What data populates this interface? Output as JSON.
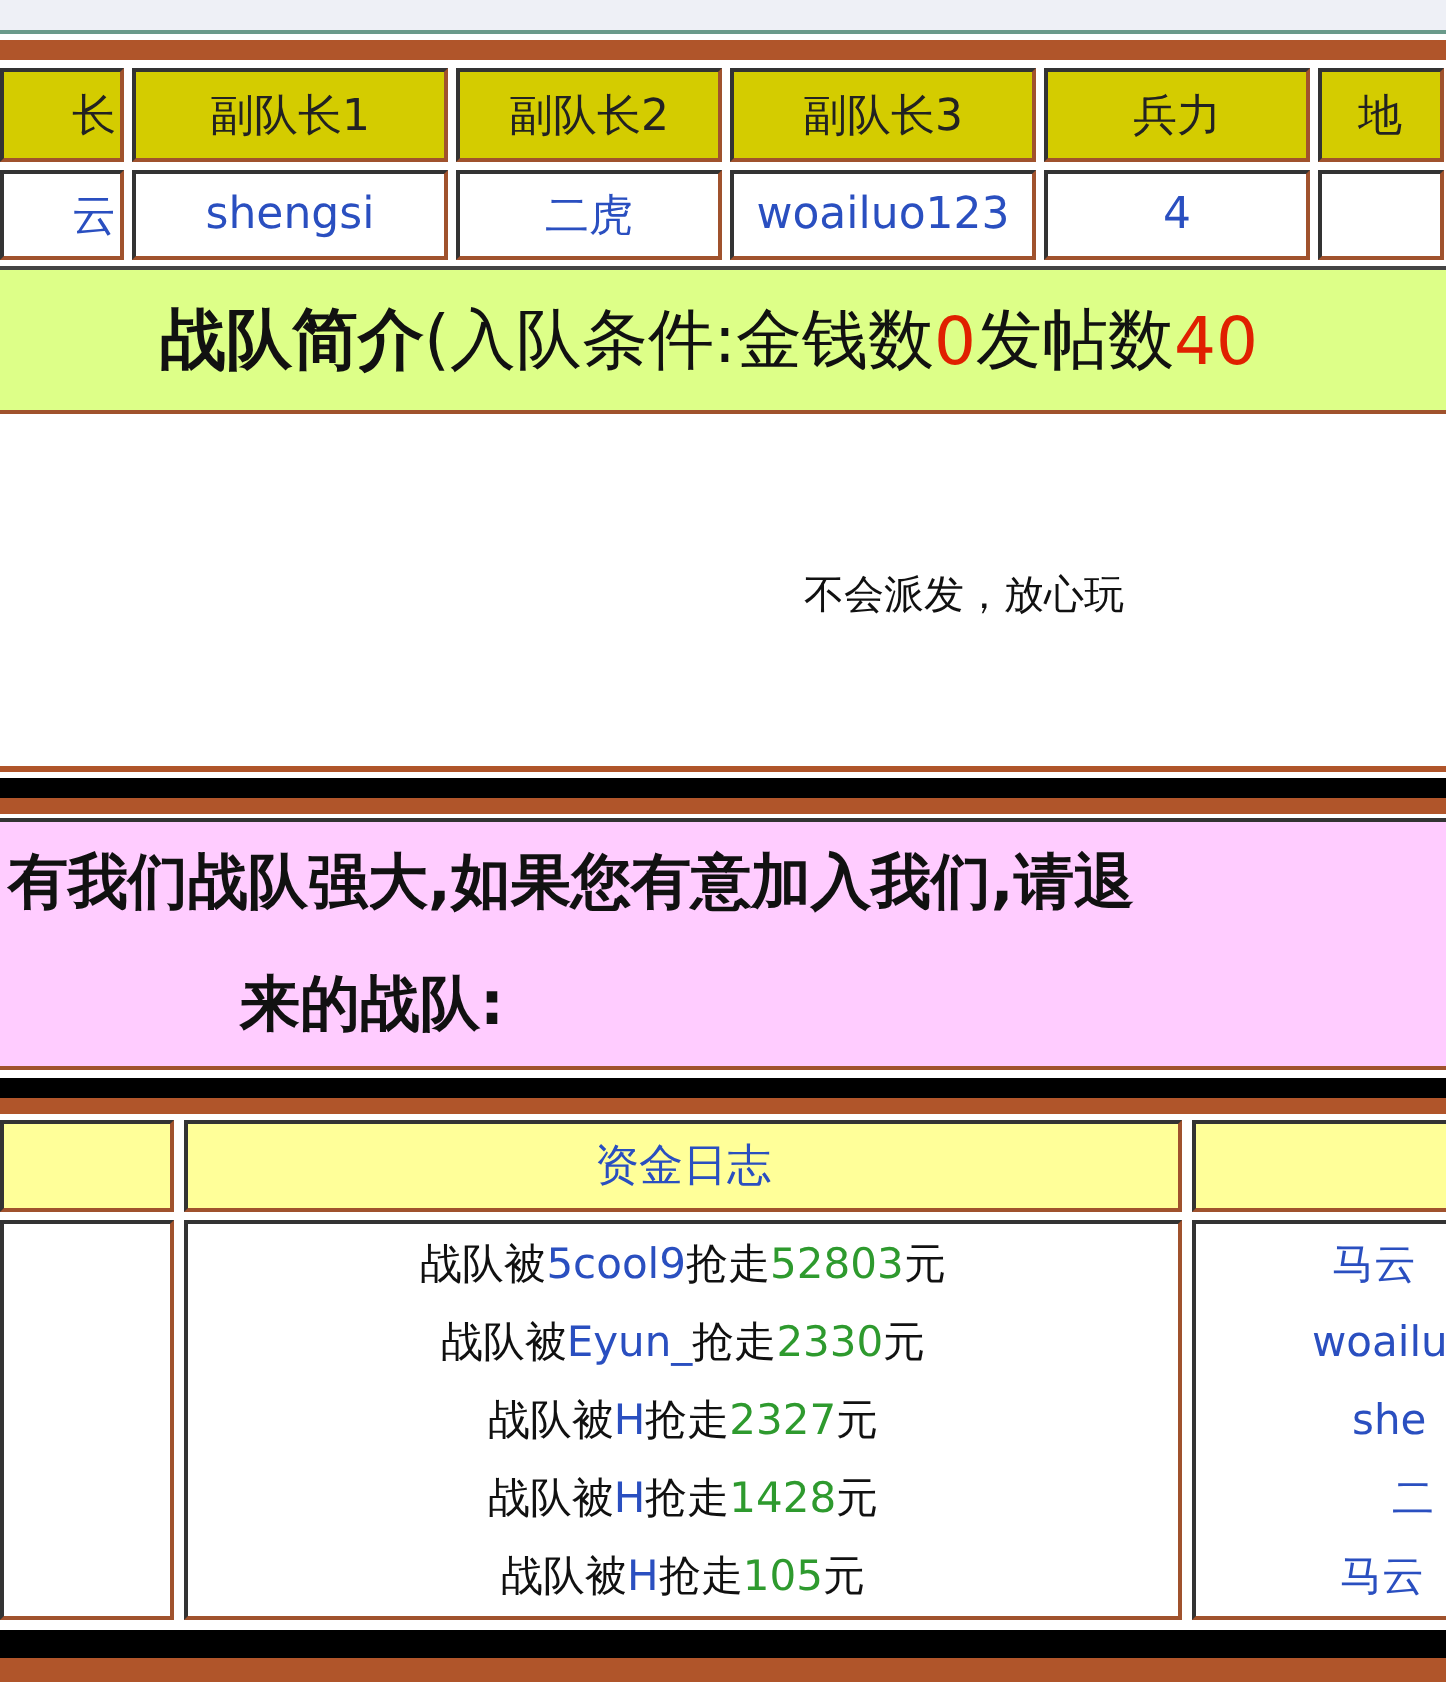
{
  "team_table": {
    "headers": [
      "长",
      "副队长1",
      "副队长2",
      "副队长3",
      "兵力",
      "地"
    ],
    "row": [
      "云",
      "shengsi",
      "二虎",
      "woailuo123",
      "4"
    ]
  },
  "intro_bar": {
    "label": "战队简介(入队条件:金钱数",
    "money": "0",
    "posts_label": "发帖数",
    "posts": "40"
  },
  "intro_text": "不会派发，放心玩",
  "notice": {
    "line_1": "有我们战队强大,如果您有意加入我们,请退",
    "line_2": "来的战队:"
  },
  "fund_log": {
    "title": "资金日志",
    "entries": [
      {
        "prefix": "战队被",
        "name": "5cool9",
        "verb": "抢走",
        "amount": "52803",
        "unit": "元"
      },
      {
        "prefix": "战队被",
        "name": "Eyun_",
        "verb": "抢走",
        "amount": "2330",
        "unit": "元"
      },
      {
        "prefix": "战队被",
        "name": "H",
        "verb": "抢走",
        "amount": "2327",
        "unit": "元"
      },
      {
        "prefix": "战队被",
        "name": "H",
        "verb": "抢走",
        "amount": "1428",
        "unit": "元"
      },
      {
        "prefix": "战队被",
        "name": "H",
        "verb": "抢走",
        "amount": "105",
        "unit": "元"
      }
    ]
  },
  "right_column": {
    "entries": [
      "马云",
      "woailu",
      "she",
      "二",
      "马云"
    ]
  }
}
